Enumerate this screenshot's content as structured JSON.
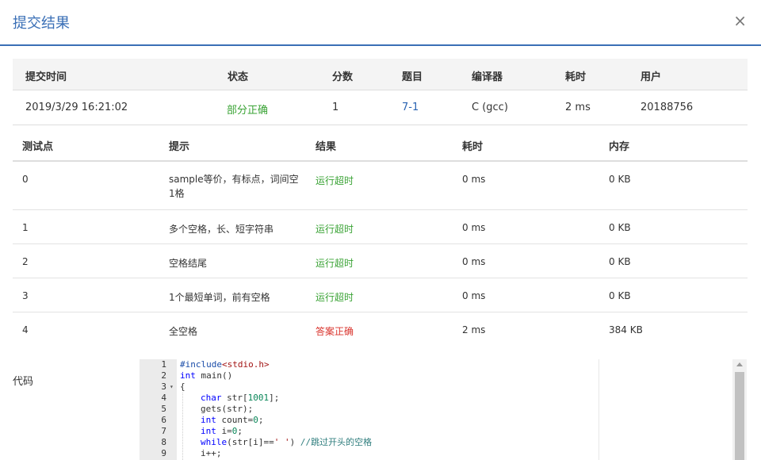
{
  "dialog": {
    "title": "提交结果",
    "close_glyph": "×"
  },
  "summary": {
    "headers": [
      "提交时间",
      "状态",
      "分数",
      "题目",
      "编译器",
      "耗时",
      "用户"
    ],
    "row": {
      "time": "2019/3/29 16:21:02",
      "status": "部分正确",
      "score": "1",
      "problem": "7-1",
      "compiler": "C (gcc)",
      "elapsed": "2 ms",
      "user": "20188756"
    }
  },
  "cases": {
    "headers": [
      "测试点",
      "提示",
      "结果",
      "耗时",
      "内存"
    ],
    "rows": [
      {
        "id": "0",
        "hint": "sample等价，有标点，词间空1格",
        "result": "运行超时",
        "time": "0 ms",
        "memory": "0 KB"
      },
      {
        "id": "1",
        "hint": "多个空格，长、短字符串",
        "result": "运行超时",
        "time": "0 ms",
        "memory": "0 KB"
      },
      {
        "id": "2",
        "hint": "空格结尾",
        "result": "运行超时",
        "time": "0 ms",
        "memory": "0 KB"
      },
      {
        "id": "3",
        "hint": "1个最短单词，前有空格",
        "result": "运行超时",
        "time": "0 ms",
        "memory": "0 KB"
      },
      {
        "id": "4",
        "hint": "全空格",
        "result": "答案正确",
        "time": "2 ms",
        "memory": "384 KB"
      }
    ]
  },
  "code": {
    "label": "代码",
    "line_numbers": [
      "1",
      "2",
      "3",
      "4",
      "5",
      "6",
      "7",
      "8",
      "9"
    ],
    "fold_marker": "▾",
    "lines": {
      "l1a": "#include",
      "l1b": "<stdio.h>",
      "l2a": "int",
      "l2b": " main()",
      "l3": "{",
      "l4a": "char",
      "l4b": " str[",
      "l4c": "1001",
      "l4d": "];",
      "l5": "gets(str);",
      "l6a": "int",
      "l6b": " count=",
      "l6c": "0",
      "l6d": ";",
      "l7a": "int",
      "l7b": " i=",
      "l7c": "0",
      "l7d": ";",
      "l8a": "while",
      "l8b": "(str[i]==",
      "l8c": "' '",
      "l8d": ") ",
      "l8e": "//跳过开头的空格",
      "l9": "i++;"
    }
  },
  "colors": {
    "accent": "#3a6fb6",
    "success": "#3aa335",
    "error": "#d9322b",
    "link": "#2a64b3"
  }
}
